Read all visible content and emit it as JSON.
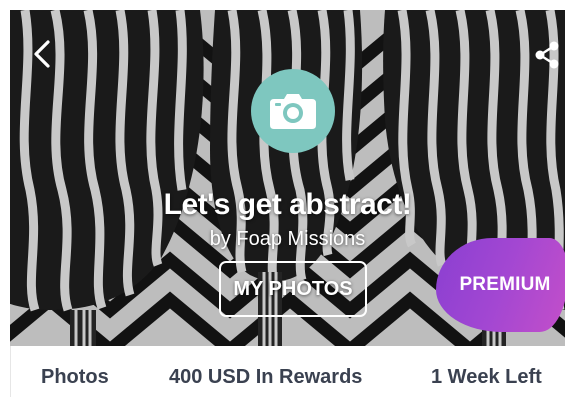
{
  "hero": {
    "title": "Let's get abstract!",
    "author": "by Foap Missions",
    "my_photos_label": "MY PHOTOS",
    "premium_label": "PREMIUM"
  },
  "stats": {
    "photos": "Photos",
    "rewards": "400 USD In Rewards",
    "time_left": "1 Week Left"
  },
  "icons": {
    "back": "chevron-left-icon",
    "share": "share-icon",
    "camera": "camera-icon"
  },
  "colors": {
    "camera_badge": "#7ec7bf",
    "premium_gradient_start": "#8a3fd1",
    "premium_gradient_end": "#c44fc9",
    "stats_text": "#3a4150"
  }
}
